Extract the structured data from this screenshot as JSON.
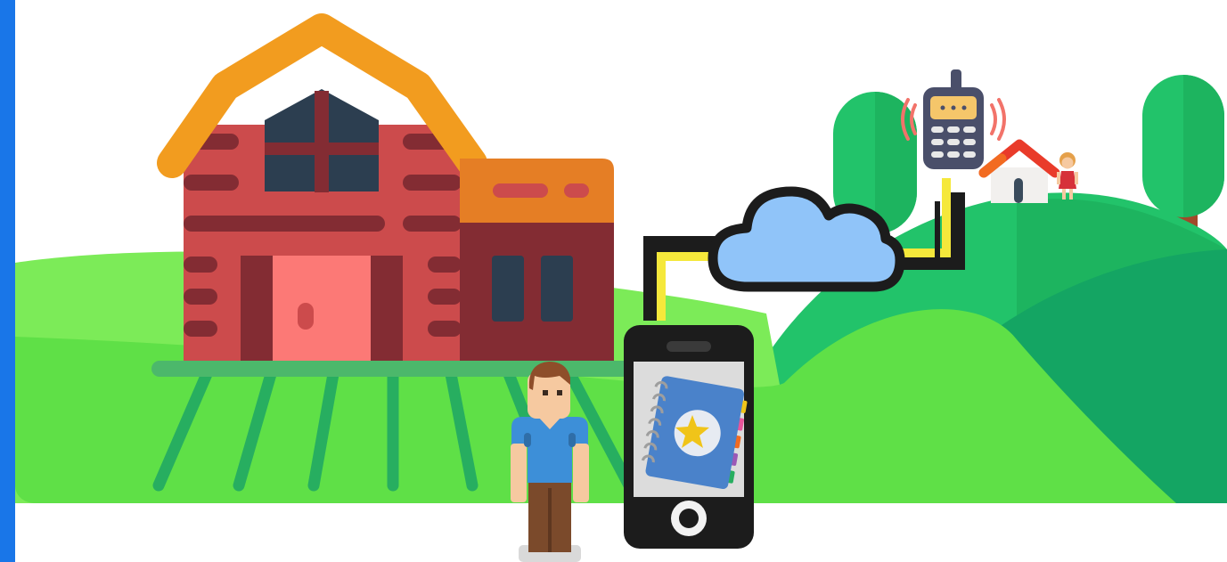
{
  "colors": {
    "accent_bar": "#1976E8",
    "grass_light": "#7CEB58",
    "grass_main": "#5FE047",
    "hill_green": "#22C36A",
    "hill_dark": "#14A563",
    "field_rows": "#27AE60",
    "barn_wall": "#CC4B4C",
    "barn_dark": "#832C33",
    "barn_door": "#FC7976",
    "roof_orange": "#F29C1F",
    "shed_roof": "#E57E25",
    "window_dark": "#2C3E50",
    "cloud_fill": "#90C4F9",
    "outline_black": "#1C1C1C",
    "cable_yellow": "#F5E83B",
    "phone_screen": "#DCDCDC",
    "book_blue": "#4A82CA",
    "star_yellow": "#F0C419",
    "house_roof": "#E93B2A",
    "tree_green": "#22C36A",
    "trunk_brown": "#A1492A"
  },
  "icons": [
    "barn-icon",
    "shed-icon",
    "field-rows-icon",
    "farmer-person-icon",
    "smartphone-icon",
    "address-book-icon",
    "star-icon",
    "cloud-icon",
    "walkie-talkie-icon",
    "signal-waves-icon",
    "house-icon",
    "girl-person-icon",
    "tree-icon"
  ]
}
